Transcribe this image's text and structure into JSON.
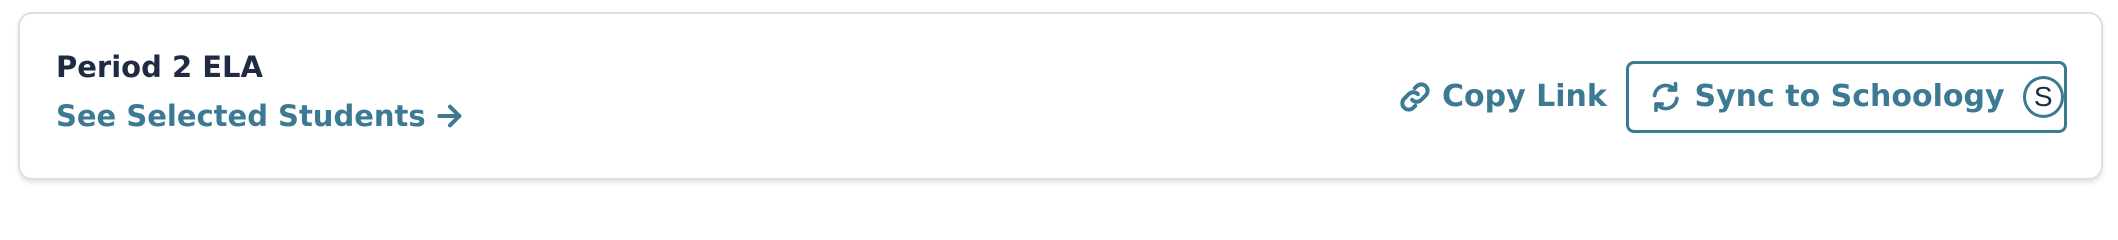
{
  "section": {
    "title": "Period 2 ELA",
    "see_selected_label": "See Selected Students",
    "see_selected_icon": "arrow-right-icon"
  },
  "actions": {
    "copy_link_label": "Copy Link",
    "copy_link_icon": "link-icon",
    "sync_label": "Sync to Schoology",
    "sync_icon": "refresh-icon",
    "schoology_logo_letter": "S"
  },
  "colors": {
    "accent": "#3c7a94",
    "title_text": "#1f2b43",
    "card_border": "#dcdfe3"
  }
}
